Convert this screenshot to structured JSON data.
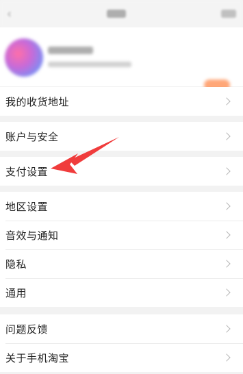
{
  "menu": {
    "address": "我的收货地址",
    "account": "账户与安全",
    "payment": "支付设置",
    "region": "地区设置",
    "sound": "音效与通知",
    "privacy": "隐私",
    "general": "通用",
    "feedback": "问题反馈",
    "about": "关于手机淘宝"
  },
  "icons": {
    "back": "back-icon",
    "chevron": "chevron-right-icon",
    "annotation": "red-arrow-annotation"
  },
  "colors": {
    "annotation": "#f03c3c",
    "background": "#f2f2f2"
  }
}
